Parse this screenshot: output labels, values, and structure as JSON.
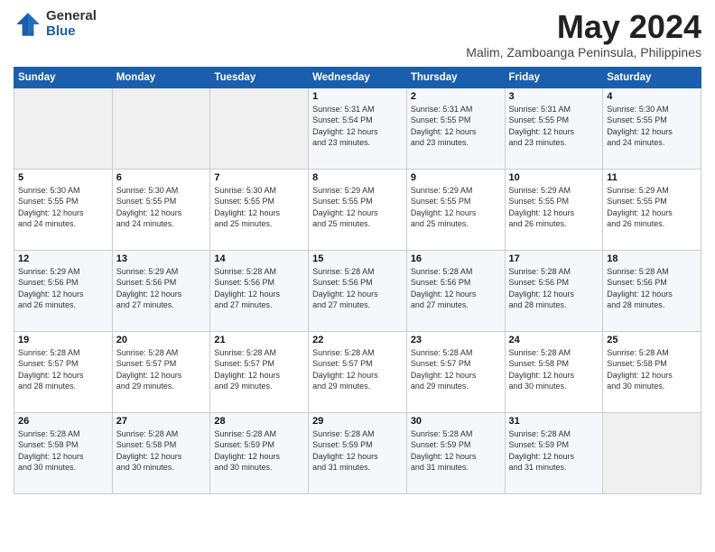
{
  "header": {
    "logo_general": "General",
    "logo_blue": "Blue",
    "month_year": "May 2024",
    "location": "Malim, Zamboanga Peninsula, Philippines"
  },
  "weekdays": [
    "Sunday",
    "Monday",
    "Tuesday",
    "Wednesday",
    "Thursday",
    "Friday",
    "Saturday"
  ],
  "weeks": [
    [
      {
        "day": "",
        "info": ""
      },
      {
        "day": "",
        "info": ""
      },
      {
        "day": "",
        "info": ""
      },
      {
        "day": "1",
        "info": "Sunrise: 5:31 AM\nSunset: 5:54 PM\nDaylight: 12 hours\nand 23 minutes."
      },
      {
        "day": "2",
        "info": "Sunrise: 5:31 AM\nSunset: 5:55 PM\nDaylight: 12 hours\nand 23 minutes."
      },
      {
        "day": "3",
        "info": "Sunrise: 5:31 AM\nSunset: 5:55 PM\nDaylight: 12 hours\nand 23 minutes."
      },
      {
        "day": "4",
        "info": "Sunrise: 5:30 AM\nSunset: 5:55 PM\nDaylight: 12 hours\nand 24 minutes."
      }
    ],
    [
      {
        "day": "5",
        "info": "Sunrise: 5:30 AM\nSunset: 5:55 PM\nDaylight: 12 hours\nand 24 minutes."
      },
      {
        "day": "6",
        "info": "Sunrise: 5:30 AM\nSunset: 5:55 PM\nDaylight: 12 hours\nand 24 minutes."
      },
      {
        "day": "7",
        "info": "Sunrise: 5:30 AM\nSunset: 5:55 PM\nDaylight: 12 hours\nand 25 minutes."
      },
      {
        "day": "8",
        "info": "Sunrise: 5:29 AM\nSunset: 5:55 PM\nDaylight: 12 hours\nand 25 minutes."
      },
      {
        "day": "9",
        "info": "Sunrise: 5:29 AM\nSunset: 5:55 PM\nDaylight: 12 hours\nand 25 minutes."
      },
      {
        "day": "10",
        "info": "Sunrise: 5:29 AM\nSunset: 5:55 PM\nDaylight: 12 hours\nand 26 minutes."
      },
      {
        "day": "11",
        "info": "Sunrise: 5:29 AM\nSunset: 5:55 PM\nDaylight: 12 hours\nand 26 minutes."
      }
    ],
    [
      {
        "day": "12",
        "info": "Sunrise: 5:29 AM\nSunset: 5:56 PM\nDaylight: 12 hours\nand 26 minutes."
      },
      {
        "day": "13",
        "info": "Sunrise: 5:29 AM\nSunset: 5:56 PM\nDaylight: 12 hours\nand 27 minutes."
      },
      {
        "day": "14",
        "info": "Sunrise: 5:28 AM\nSunset: 5:56 PM\nDaylight: 12 hours\nand 27 minutes."
      },
      {
        "day": "15",
        "info": "Sunrise: 5:28 AM\nSunset: 5:56 PM\nDaylight: 12 hours\nand 27 minutes."
      },
      {
        "day": "16",
        "info": "Sunrise: 5:28 AM\nSunset: 5:56 PM\nDaylight: 12 hours\nand 27 minutes."
      },
      {
        "day": "17",
        "info": "Sunrise: 5:28 AM\nSunset: 5:56 PM\nDaylight: 12 hours\nand 28 minutes."
      },
      {
        "day": "18",
        "info": "Sunrise: 5:28 AM\nSunset: 5:56 PM\nDaylight: 12 hours\nand 28 minutes."
      }
    ],
    [
      {
        "day": "19",
        "info": "Sunrise: 5:28 AM\nSunset: 5:57 PM\nDaylight: 12 hours\nand 28 minutes."
      },
      {
        "day": "20",
        "info": "Sunrise: 5:28 AM\nSunset: 5:57 PM\nDaylight: 12 hours\nand 29 minutes."
      },
      {
        "day": "21",
        "info": "Sunrise: 5:28 AM\nSunset: 5:57 PM\nDaylight: 12 hours\nand 29 minutes."
      },
      {
        "day": "22",
        "info": "Sunrise: 5:28 AM\nSunset: 5:57 PM\nDaylight: 12 hours\nand 29 minutes."
      },
      {
        "day": "23",
        "info": "Sunrise: 5:28 AM\nSunset: 5:57 PM\nDaylight: 12 hours\nand 29 minutes."
      },
      {
        "day": "24",
        "info": "Sunrise: 5:28 AM\nSunset: 5:58 PM\nDaylight: 12 hours\nand 30 minutes."
      },
      {
        "day": "25",
        "info": "Sunrise: 5:28 AM\nSunset: 5:58 PM\nDaylight: 12 hours\nand 30 minutes."
      }
    ],
    [
      {
        "day": "26",
        "info": "Sunrise: 5:28 AM\nSunset: 5:58 PM\nDaylight: 12 hours\nand 30 minutes."
      },
      {
        "day": "27",
        "info": "Sunrise: 5:28 AM\nSunset: 5:58 PM\nDaylight: 12 hours\nand 30 minutes."
      },
      {
        "day": "28",
        "info": "Sunrise: 5:28 AM\nSunset: 5:59 PM\nDaylight: 12 hours\nand 30 minutes."
      },
      {
        "day": "29",
        "info": "Sunrise: 5:28 AM\nSunset: 5:59 PM\nDaylight: 12 hours\nand 31 minutes."
      },
      {
        "day": "30",
        "info": "Sunrise: 5:28 AM\nSunset: 5:59 PM\nDaylight: 12 hours\nand 31 minutes."
      },
      {
        "day": "31",
        "info": "Sunrise: 5:28 AM\nSunset: 5:59 PM\nDaylight: 12 hours\nand 31 minutes."
      },
      {
        "day": "",
        "info": ""
      }
    ]
  ]
}
